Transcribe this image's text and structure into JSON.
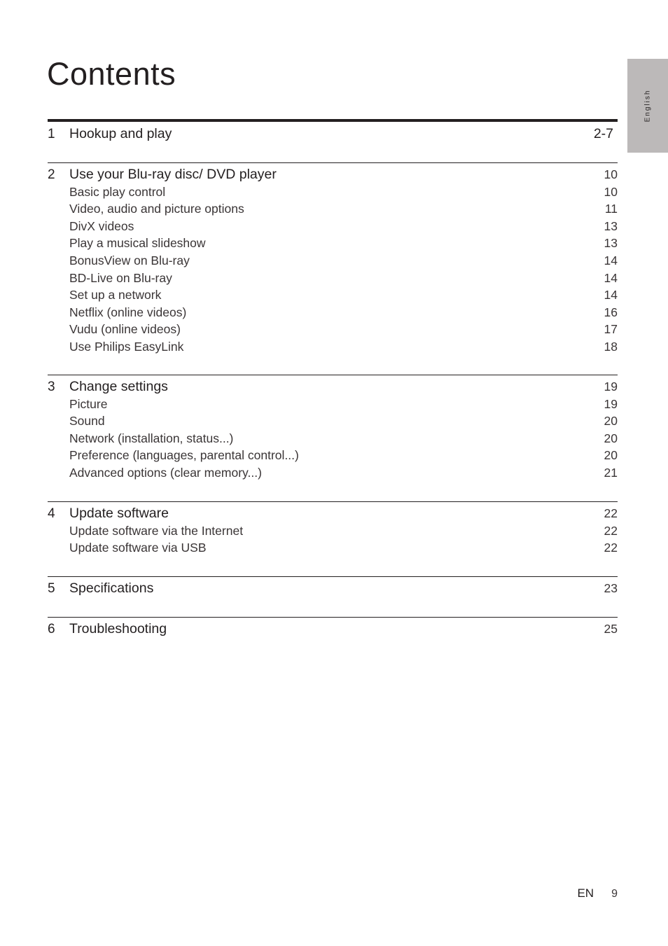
{
  "title": "Contents",
  "language_tab": "English",
  "sections": [
    {
      "number": "1",
      "title": "Hookup and play",
      "page": "2-7",
      "entries": []
    },
    {
      "number": "2",
      "title": "Use your Blu-ray disc/ DVD player",
      "page": "10",
      "entries": [
        {
          "title": "Basic play control",
          "page": "10"
        },
        {
          "title": "Video, audio and picture options",
          "page": "11"
        },
        {
          "title": "DivX videos",
          "page": "13"
        },
        {
          "title": "Play a musical slideshow",
          "page": "13"
        },
        {
          "title": "BonusView on Blu-ray",
          "page": "14"
        },
        {
          "title": "BD-Live on Blu-ray",
          "page": "14"
        },
        {
          "title": "Set up a network",
          "page": "14"
        },
        {
          "title": "Netflix (online videos)",
          "page": "16"
        },
        {
          "title": "Vudu (online videos)",
          "page": "17"
        },
        {
          "title": "Use Philips EasyLink",
          "page": "18"
        }
      ]
    },
    {
      "number": "3",
      "title": "Change settings",
      "page": "19",
      "entries": [
        {
          "title": "Picture",
          "page": "19"
        },
        {
          "title": "Sound",
          "page": "20"
        },
        {
          "title": "Network (installation, status...)",
          "page": "20"
        },
        {
          "title": "Preference (languages, parental control...)",
          "page": "20"
        },
        {
          "title": "Advanced options (clear memory...)",
          "page": "21"
        }
      ]
    },
    {
      "number": "4",
      "title": "Update software",
      "page": "22",
      "entries": [
        {
          "title": "Update software via the Internet",
          "page": "22"
        },
        {
          "title": "Update software via USB",
          "page": "22"
        }
      ]
    },
    {
      "number": "5",
      "title": "Specifications",
      "page": "23",
      "entries": []
    },
    {
      "number": "6",
      "title": "Troubleshooting",
      "page": "25",
      "entries": []
    }
  ],
  "footer": {
    "language": "EN",
    "page_number": "9"
  }
}
